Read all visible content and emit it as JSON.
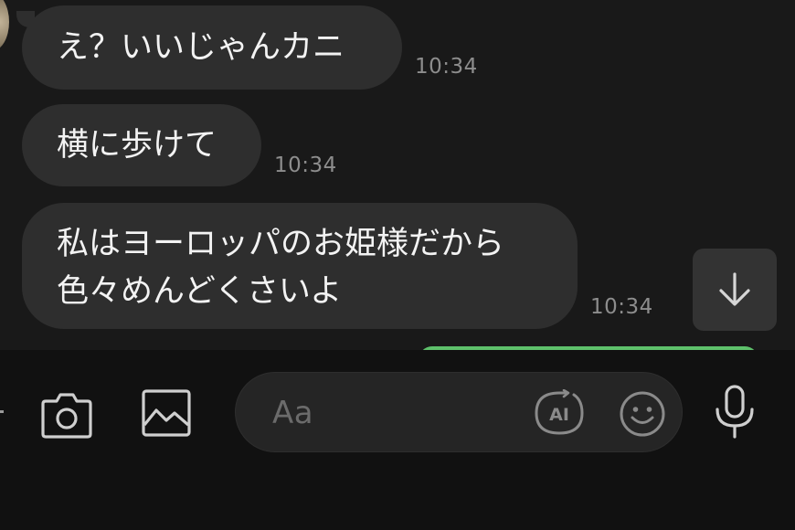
{
  "messages": [
    {
      "text": "え？いいじゃんカニ",
      "time": "10:34"
    },
    {
      "text": "横に歩けて",
      "time": "10:34"
    },
    {
      "lines": [
        "私はヨーロッパのお姫様だから",
        "色々めんどくさいよ"
      ],
      "time": "10:34"
    }
  ],
  "composer": {
    "placeholder": "Aa",
    "ai_label": "AI"
  },
  "icons": {
    "camera": "camera-icon",
    "image": "image-icon",
    "mic": "microphone-icon",
    "emoji": "emoji-icon",
    "ai": "ai-icon",
    "scroll": "arrow-down-icon"
  },
  "colors": {
    "background": "#191919",
    "bubble": "#2e2e2e",
    "sent_bubble": "#5ec16b",
    "timestamp": "#8d8d8d"
  }
}
